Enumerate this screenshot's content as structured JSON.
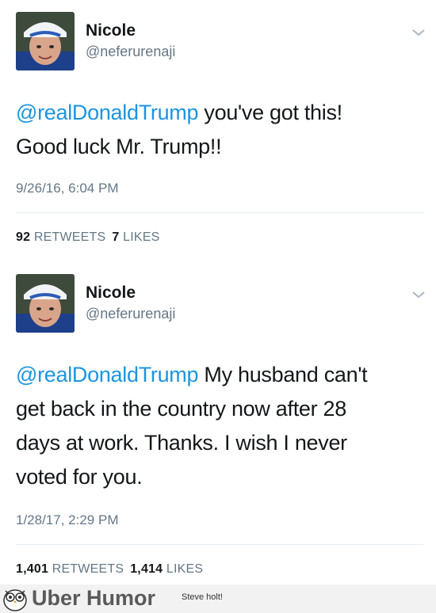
{
  "tweets": [
    {
      "user": {
        "name": "Nicole",
        "handle": "@neferurenaji"
      },
      "mention": "@realDonaldTrump",
      "text_line1": " you've got this!",
      "text_line2": "Good luck Mr. Trump!!",
      "timestamp": "9/26/16, 6:04 PM",
      "retweets_count": "92",
      "retweets_label": "RETWEETS",
      "likes_count": "7",
      "likes_label": "LIKES"
    },
    {
      "user": {
        "name": "Nicole",
        "handle": "@neferurenaji"
      },
      "mention": "@realDonaldTrump",
      "text_line1": " My husband can't",
      "text_line2": "get back in the country now after 28",
      "text_line3": "days at work.  Thanks.  I wish I never",
      "text_line4": "voted for you.",
      "timestamp": "1/28/17, 2:29 PM",
      "retweets_count": "1,401",
      "retweets_label": "RETWEETS",
      "likes_count": "1,414",
      "likes_label": "LIKES"
    }
  ],
  "footer": {
    "brand": "Uber Humor",
    "caption": "Steve holt!"
  },
  "icons": {
    "menu": "chevron-down-icon",
    "logo": "owl-icon"
  },
  "colors": {
    "mention": "#1b95e0",
    "secondary_text": "#657786",
    "divider": "#e6ecf0"
  }
}
